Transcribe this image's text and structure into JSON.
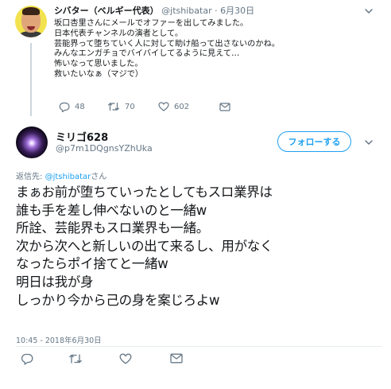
{
  "parent_tweet": {
    "author_name": "シバター（ベルギー代表）",
    "handle": "@jtshibatar",
    "separator": "·",
    "date": "6月30日",
    "text_lines": [
      "坂口杏里さんにメールでオファーを出してみました。",
      "日本代表チャンネルの演者として。",
      "芸能界って堕ちていく人に対して助け船って出さないのかね。",
      "みんなエンガチョでバイバイしてるように見えて…",
      "怖いなって思いました。",
      "救いたいなぁ（マジで）"
    ],
    "replies": "48",
    "retweets": "70",
    "likes": "602"
  },
  "main_tweet": {
    "author_name": "ミリゴ628",
    "handle": "@p7m1DQgnsYZhUka",
    "follow_label": "フォローする",
    "reply_prefix": "返信先:",
    "reply_mention": "@jtshibatar",
    "reply_suffix": "さん",
    "text_lines": [
      "まぁお前が堕ちていったとしてもスロ業界は",
      "誰も手を差し伸べないのと一緒w",
      "所詮、芸能界もスロ業界も一緒。",
      "次から次へと新しいの出て来るし、用がなく",
      "なったらポイ捨てと一緒w",
      "明日は我が身",
      "しっかり今から己の身を案じろよw"
    ],
    "timestamp": "10:45 - 2018年6月30日"
  },
  "icons": {
    "reply": "reply-icon",
    "retweet": "retweet-icon",
    "like": "heart-icon",
    "dm": "mail-icon",
    "more": "chevron-down-icon"
  },
  "colors": {
    "accent": "#1da1f2",
    "muted": "#657786",
    "text": "#14171a",
    "divider": "#e6ecf0"
  }
}
